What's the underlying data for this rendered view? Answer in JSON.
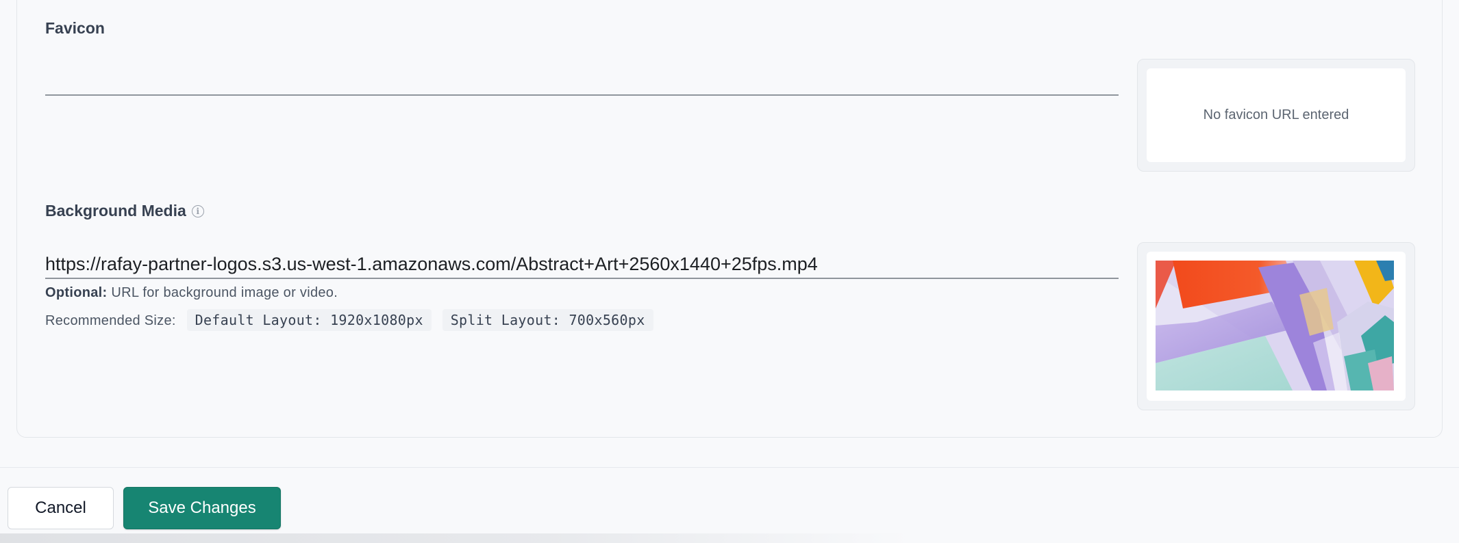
{
  "favicon": {
    "label": "Favicon",
    "value": "",
    "preview_text": "No favicon URL entered"
  },
  "background_media": {
    "label": "Background Media",
    "info_icon": "info-circle-icon",
    "value": "https://rafay-partner-logos.s3.us-west-1.amazonaws.com/Abstract+Art+2560x1440+25fps.mp4",
    "helper_optional": "Optional:",
    "helper_text": "URL for background image or video.",
    "recommended_label": "Recommended Size:",
    "default_layout": "Default Layout: 1920x1080px",
    "split_layout": "Split Layout: 700x560px",
    "preview_image": "abstract-art-thumbnail"
  },
  "actions": {
    "cancel_label": "Cancel",
    "save_label": "Save Changes"
  },
  "colors": {
    "primary": "#178572",
    "background": "#f8f9fb"
  }
}
